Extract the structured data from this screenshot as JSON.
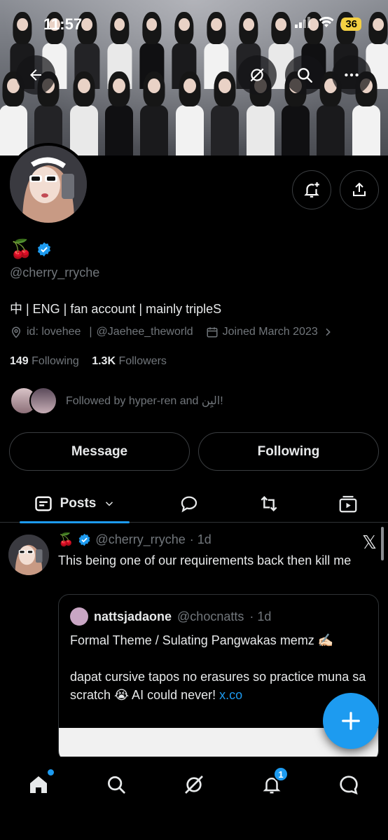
{
  "status_bar": {
    "time": "11:57",
    "battery": "36"
  },
  "profile": {
    "name_emoji": "🍒",
    "handle": "@cherry_rryche",
    "bio": "中 | ENG | fan account | mainly tripleS",
    "location": "id: lovehee",
    "website": "@Jaehee_theworld",
    "joined": "Joined March 2023",
    "following_count": "149",
    "following_label": "Following",
    "followers_count": "1.3K",
    "followers_label": "Followers",
    "followed_by": "Followed by hyper-ren and اليِن!"
  },
  "buttons": {
    "message": "Message",
    "following": "Following"
  },
  "tabs": {
    "posts": "Posts"
  },
  "post": {
    "name_emoji": "🍒",
    "handle": "@cherry_rryche",
    "time": "· 1d",
    "text": "This being one of our requirements back then kill me",
    "quote": {
      "name": "nattsjadaone",
      "handle": "@chocnatts",
      "time": "· 1d",
      "line1": "Formal Theme / Sulating Pangwakas memz ✍🏻",
      "line2": "dapat cursive tapos no erasures so practice muna sa scratch 😭 AI could never!",
      "link": "x.co"
    }
  },
  "bottom_nav": {
    "notifications_badge": "1"
  },
  "icons": [
    "back-arrow-icon",
    "grok-icon",
    "search-icon",
    "more-icon",
    "notification-add-icon",
    "share-icon",
    "location-icon",
    "calendar-icon",
    "chevron-right-icon",
    "verified-icon",
    "posts-icon",
    "chevron-down-icon",
    "replies-icon",
    "repost-icon",
    "media-icon",
    "x-logo-icon",
    "plus-icon",
    "home-icon",
    "search-icon",
    "grok-icon",
    "bell-icon",
    "messages-icon"
  ],
  "colors": {
    "accent": "#1d9bf0",
    "background": "#000000",
    "secondary_text": "#71767b",
    "battery": "#f5d042"
  }
}
